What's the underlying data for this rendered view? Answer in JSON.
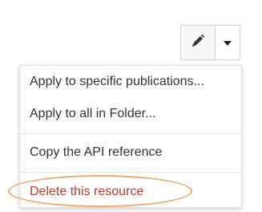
{
  "toolbar": {
    "edit_icon": "pencil-icon",
    "caret_icon": "caret-down-icon"
  },
  "menu": {
    "items": [
      {
        "label": "Apply to specific publications..."
      },
      {
        "label": "Apply to all in Folder..."
      },
      {
        "label": "Copy the API reference"
      },
      {
        "label": "Delete this resource"
      }
    ]
  },
  "colors": {
    "danger": "#c0392b",
    "highlight": "#f0a86b"
  }
}
